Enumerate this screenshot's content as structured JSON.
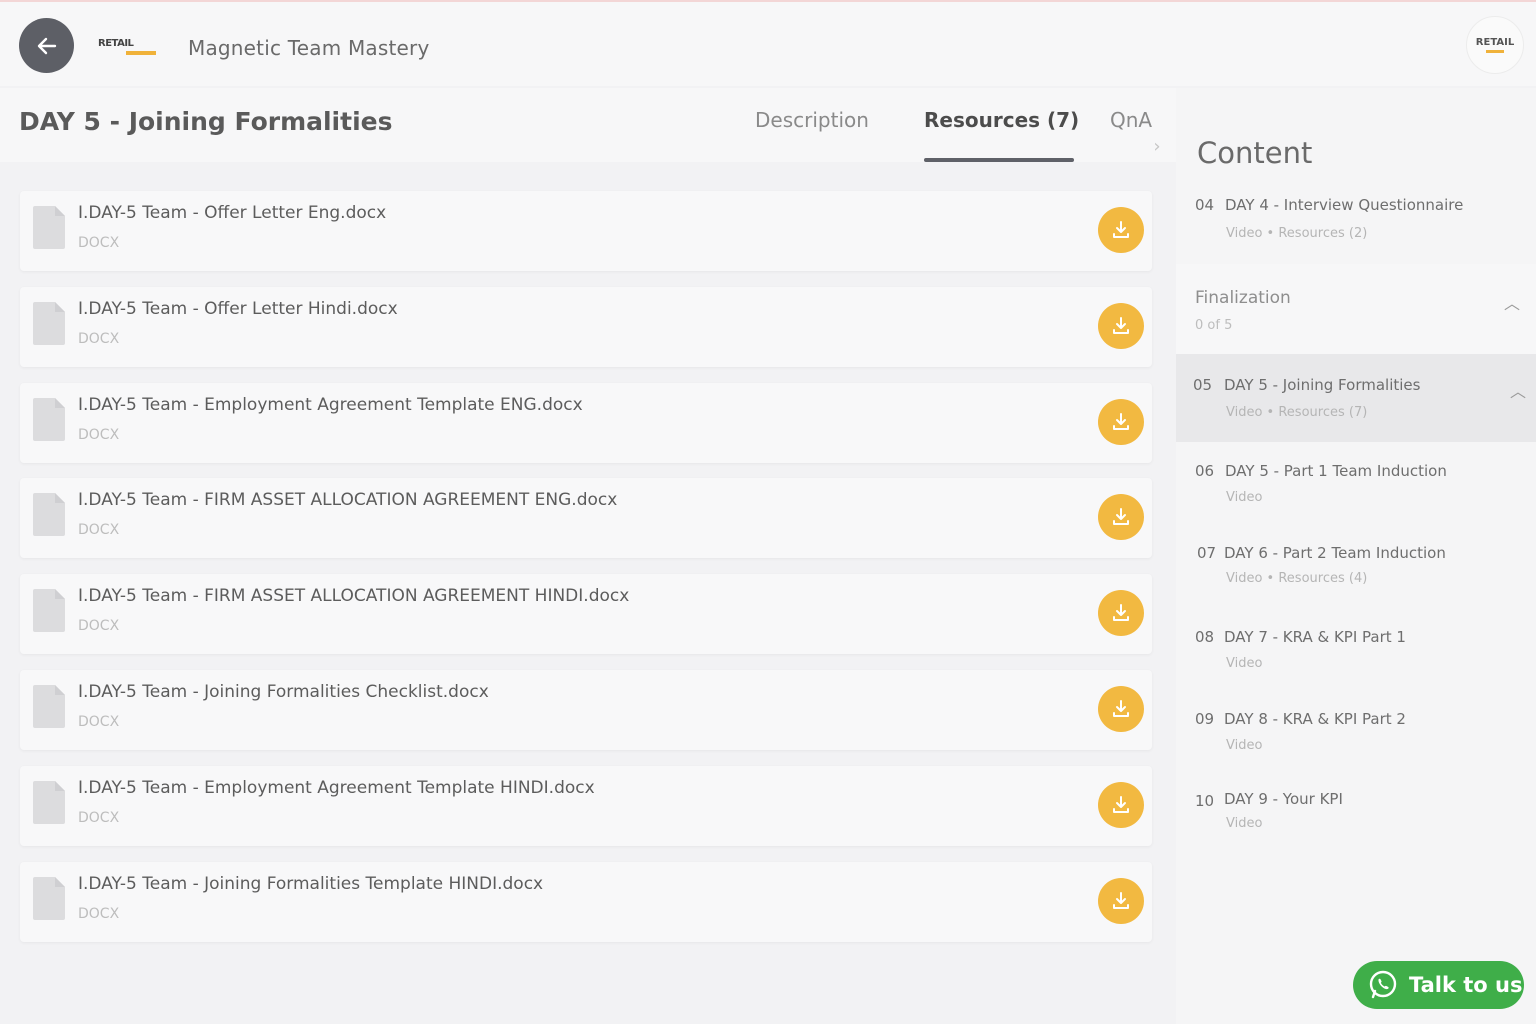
{
  "header": {
    "brand_logo_text": "RETAIL",
    "course_title": "Magnetic Team Mastery",
    "avatar_logo_text": "RETAIL"
  },
  "lesson": {
    "title": "DAY 5 - Joining Formalities",
    "tabs": [
      {
        "label": "Description",
        "active": false
      },
      {
        "label": "Resources (7)",
        "active": true
      },
      {
        "label": "QnA",
        "active": false
      }
    ]
  },
  "resources": [
    {
      "name": "I.DAY-5 Team - Offer Letter Eng.docx",
      "type": "DOCX"
    },
    {
      "name": "I.DAY-5 Team - Offer Letter Hindi.docx",
      "type": "DOCX"
    },
    {
      "name": "I.DAY-5 Team - Employment Agreement Template ENG.docx",
      "type": "DOCX"
    },
    {
      "name": "I.DAY-5 Team - FIRM ASSET ALLOCATION AGREEMENT ENG.docx",
      "type": "DOCX"
    },
    {
      "name": "I.DAY-5 Team - FIRM ASSET ALLOCATION AGREEMENT HINDI.docx",
      "type": "DOCX"
    },
    {
      "name": "I.DAY-5 Team - Joining Formalities Checklist.docx",
      "type": "DOCX"
    },
    {
      "name": "I.DAY-5 Team - Employment Agreement Template HINDI.docx",
      "type": "DOCX"
    },
    {
      "name": "I.DAY-5 Team - Joining Formalities Template HINDI.docx",
      "type": "DOCX"
    }
  ],
  "sidebar": {
    "heading": "Content",
    "item_04": {
      "num": "04",
      "title": "DAY 4 - Interview Questionnaire",
      "meta": "Video • Resources (2)"
    },
    "section": {
      "title": "Finalization",
      "progress": "0 of 5"
    },
    "items": [
      {
        "num": "05",
        "title": "DAY 5 - Joining Formalities",
        "meta": "Video • Resources (7)",
        "current": true
      },
      {
        "num": "06",
        "title": "DAY 5 - Part 1 Team Induction",
        "meta": "Video"
      },
      {
        "num": "07",
        "title": "DAY 6 - Part 2 Team Induction",
        "meta": "Video • Resources (4)"
      },
      {
        "num": "08",
        "title": "DAY 7 - KRA & KPI Part 1",
        "meta": "Video"
      },
      {
        "num": "09",
        "title": "DAY 8 - KRA & KPI Part 2",
        "meta": "Video"
      },
      {
        "num": "10",
        "title": "DAY 9 - Your KPI",
        "meta": "Video"
      }
    ]
  },
  "chat": {
    "label": "Talk to us"
  },
  "colors": {
    "accent": "#f2b941",
    "chat": "#3fae49",
    "back_button": "#5d5f66"
  }
}
